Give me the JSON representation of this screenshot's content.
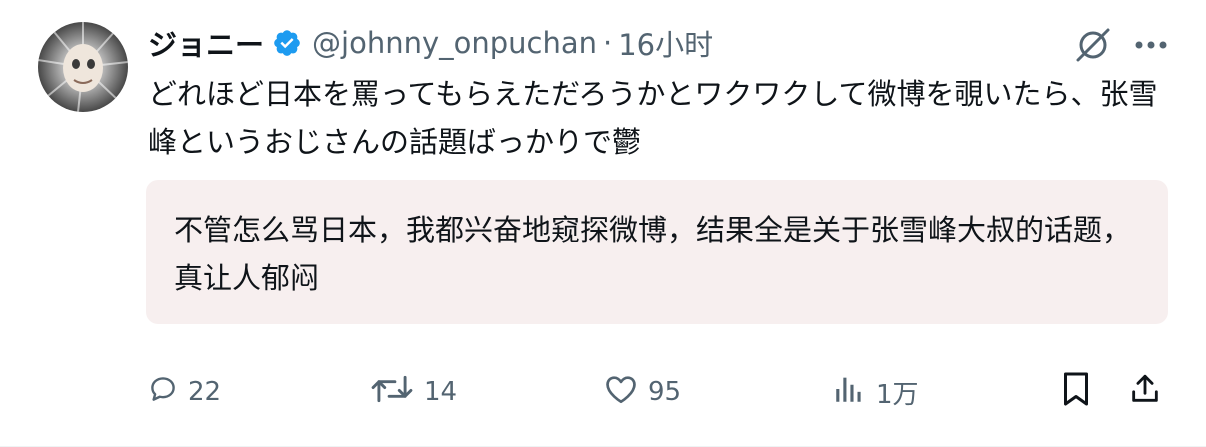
{
  "author": {
    "display_name": "ジョニー",
    "handle": "@johnny_onpuchan",
    "time": "16小时",
    "separator": "·"
  },
  "post": {
    "text": "どれほど日本を罵ってもらえただろうかとワクワクして微博を覗いたら、张雪峰というおじさんの話題ばっかりで鬱",
    "translation": "不管怎么骂日本，我都兴奋地窥探微博，结果全是关于张雪峰大叔的话题，真让人郁闷"
  },
  "metrics": {
    "replies": "22",
    "reposts": "14",
    "likes": "95",
    "views": "1万"
  },
  "icons": {
    "verified": "verified-badge-icon",
    "grok": "grok-icon",
    "more": "more-icon",
    "reply": "reply-icon",
    "repost": "repost-icon",
    "like": "like-icon",
    "views": "views-icon",
    "bookmark": "bookmark-icon",
    "share": "share-icon"
  },
  "colors": {
    "verified": "#1d9bf0",
    "muted": "#536471",
    "text": "#0f1419",
    "translation_bg": "#f7efef"
  }
}
